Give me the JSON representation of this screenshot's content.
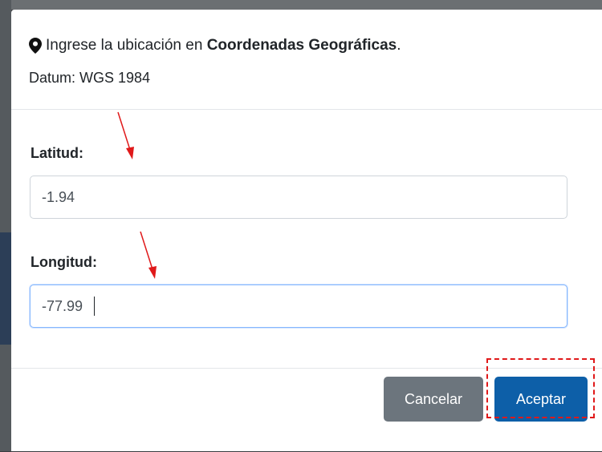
{
  "modal": {
    "header": {
      "icon": "map-marker-icon",
      "line1_prefix": "Ingrese la ubicación en ",
      "line1_bold": "Coordenadas Geográficas",
      "line1_suffix": ".",
      "line2": "Datum: WGS 1984"
    },
    "fields": [
      {
        "label": "Latitud:",
        "value": "-1.94"
      },
      {
        "label": "Longitud:",
        "value": "-77.99"
      }
    ],
    "footer": {
      "cancel_label": "Cancelar",
      "accept_label": "Aceptar"
    }
  },
  "annotations": {
    "arrow_color": "#e0191a",
    "highlight_color": "#e0191a",
    "highlight_target": "accept-button"
  },
  "colors": {
    "cancel_button": "#6c757d",
    "accept_button": "#0d5fa8",
    "focus_border": "#86b7fe"
  }
}
